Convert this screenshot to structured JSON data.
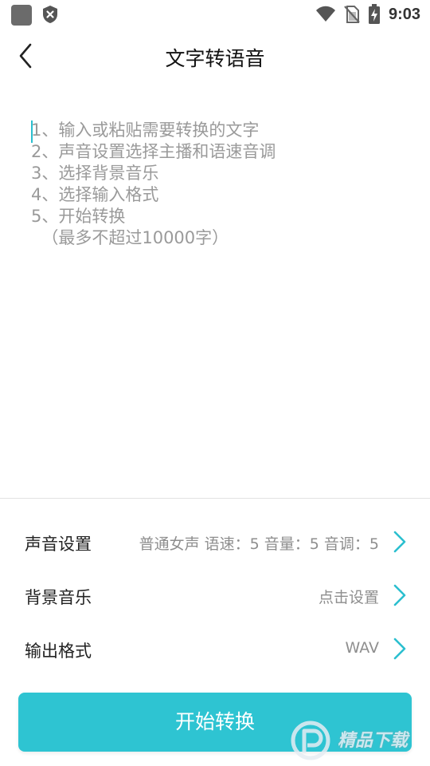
{
  "status_bar": {
    "time": "9:03",
    "icons": [
      "app-icon",
      "shield-icon",
      "wifi-icon",
      "no-sim-icon",
      "battery-charging-icon"
    ]
  },
  "toolbar": {
    "title": "文字转语音",
    "back_icon": "chevron-left-icon"
  },
  "editor": {
    "placeholder_lines": [
      "1、输入或粘贴需要转换的文字",
      "2、声音设置选择主播和语速音调",
      "3、选择背景音乐",
      "4、选择输入格式",
      "5、开始转换",
      "  （最多不超过10000字）"
    ]
  },
  "settings": {
    "voice": {
      "label": "声音设置",
      "value": "普通女声 语速：5 音量：5 音调：5"
    },
    "bgm": {
      "label": "背景音乐",
      "value": "点击设置"
    },
    "format": {
      "label": "输出格式",
      "value": "WAV"
    }
  },
  "start_button": {
    "label": "开始转换"
  },
  "watermark": {
    "text": "精品下载"
  },
  "colors": {
    "accent": "#2ec4d2",
    "chevron": "#2bbfcf",
    "placeholder": "#9a9a9a"
  }
}
